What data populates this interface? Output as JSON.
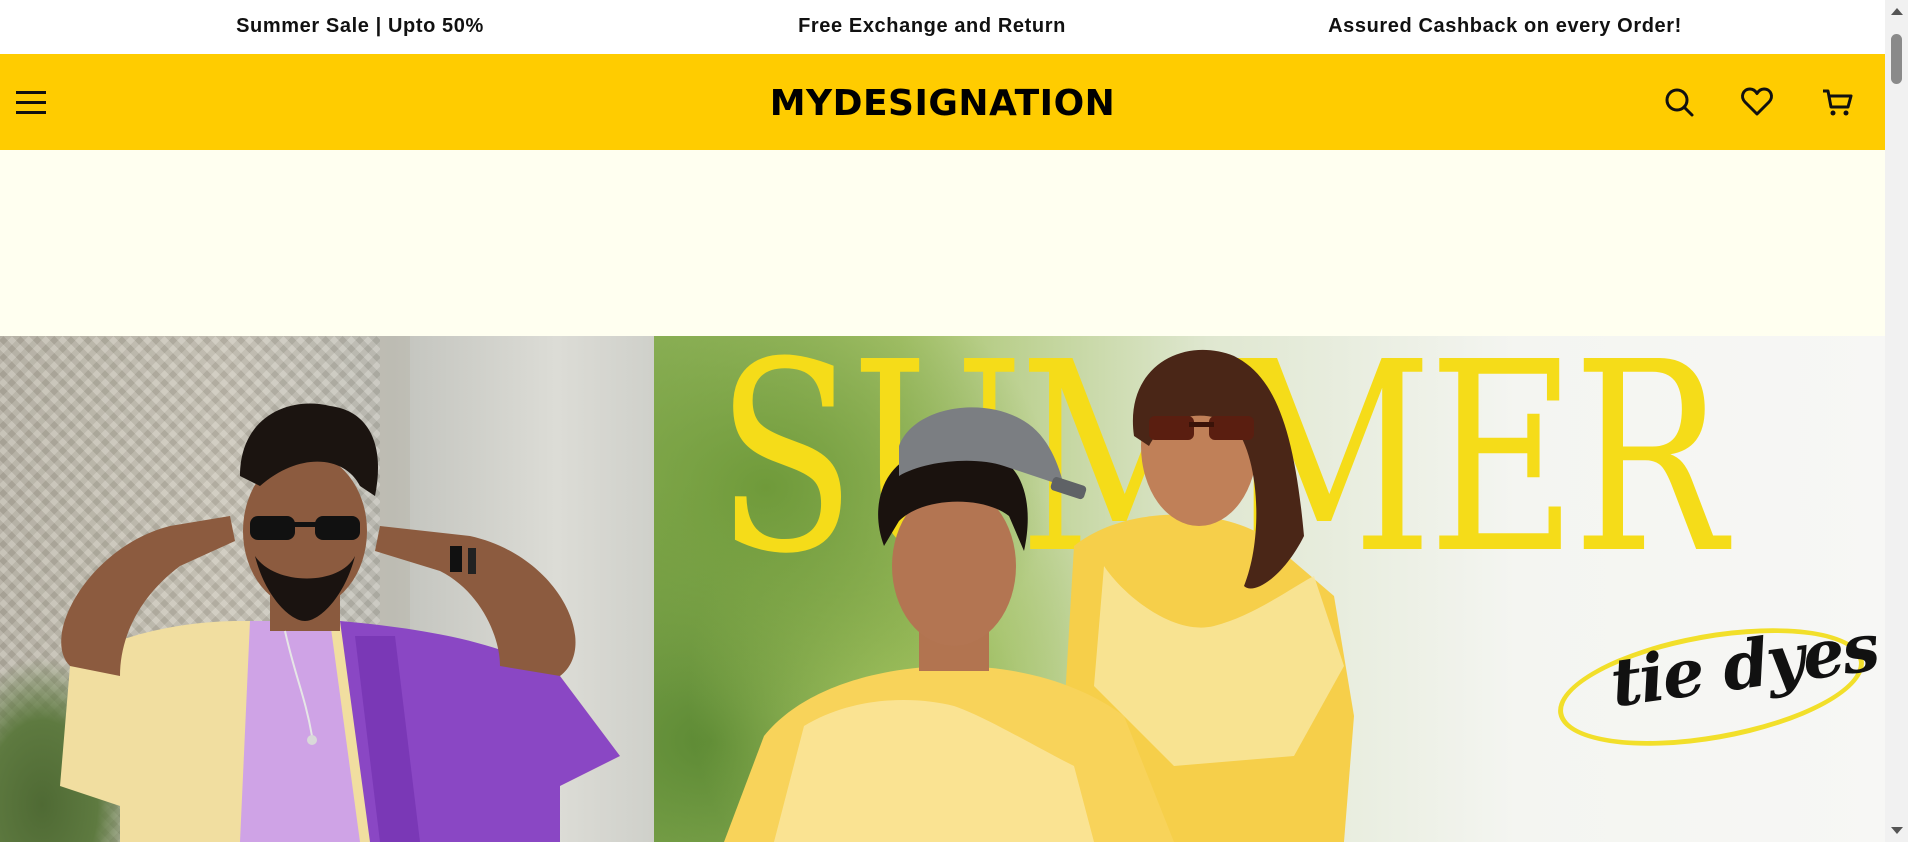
{
  "announcement_bar": {
    "items": [
      "Summer Sale | Upto 50%",
      "Free Exchange and Return",
      "Assured Cashback on every Order!"
    ]
  },
  "header": {
    "logo_text": "MYDESIGNATION",
    "background_color": "#ffcc00",
    "icons": [
      "menu-icon",
      "search-icon",
      "heart-icon",
      "cart-icon"
    ]
  },
  "promo_strip": {
    "background_color": "#fffff0"
  },
  "hero": {
    "headline": "SUMMER",
    "tagline": "tie dyes",
    "accent_color": "#f5dc19"
  }
}
